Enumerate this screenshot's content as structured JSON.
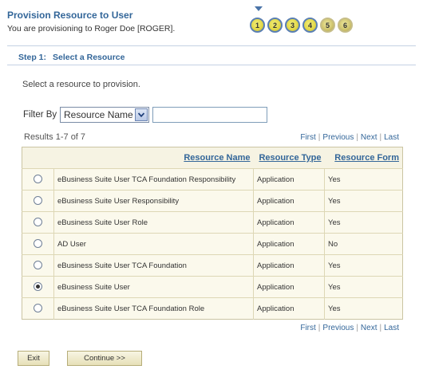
{
  "header": {
    "title": "Provision Resource to User",
    "subtitle": "You are provisioning to Roger Doe [ROGER]."
  },
  "train": {
    "current_step": 1,
    "steps": [
      "1",
      "2",
      "3",
      "4",
      "5",
      "6"
    ],
    "completed_color": "#e3d94a",
    "pending_color": "#cfc46c"
  },
  "step": {
    "number_label": "Step 1:",
    "title": "Select a Resource",
    "instruction": "Select a resource to provision."
  },
  "filter": {
    "label": "Filter By",
    "selected": "Resource Name",
    "input_value": ""
  },
  "results": {
    "summary": "Results 1-7 of 7",
    "pager": {
      "first": "First",
      "previous": "Previous",
      "next": "Next",
      "last": "Last"
    },
    "columns": [
      "Resource Name",
      "Resource Type",
      "Resource Form"
    ],
    "rows": [
      {
        "name": "eBusiness Suite User TCA Foundation Responsibility",
        "type": "Application",
        "form": "Yes",
        "selected": false
      },
      {
        "name": "eBusiness Suite User Responsibility",
        "type": "Application",
        "form": "Yes",
        "selected": false
      },
      {
        "name": "eBusiness Suite User Role",
        "type": "Application",
        "form": "Yes",
        "selected": false
      },
      {
        "name": "AD User",
        "type": "Application",
        "form": "No",
        "selected": false
      },
      {
        "name": "eBusiness Suite User TCA Foundation",
        "type": "Application",
        "form": "Yes",
        "selected": false
      },
      {
        "name": "eBusiness Suite User",
        "type": "Application",
        "form": "Yes",
        "selected": true
      },
      {
        "name": "eBusiness Suite User TCA Foundation Role",
        "type": "Application",
        "form": "Yes",
        "selected": false
      }
    ]
  },
  "actions": {
    "exit": "Exit",
    "continue": "Continue >>"
  },
  "colors": {
    "accent": "#336699",
    "table_bg": "#fbf9ec",
    "table_header_bg": "#f6f3e3"
  }
}
